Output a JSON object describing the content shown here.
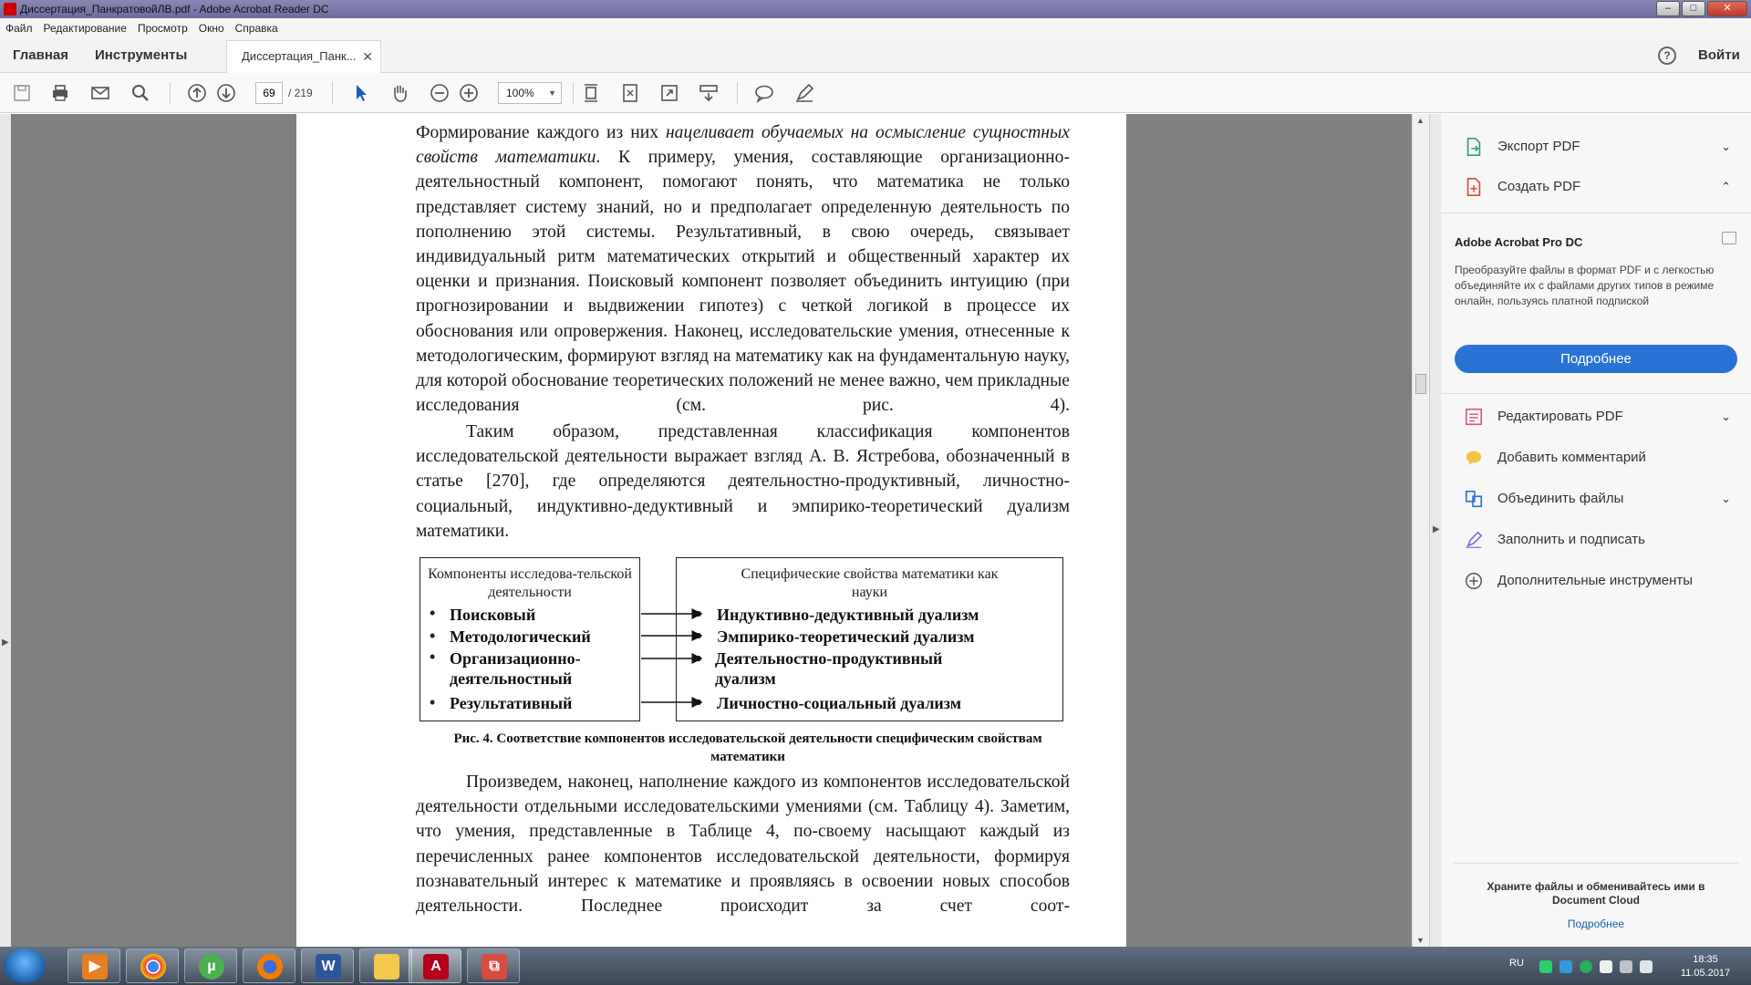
{
  "window": {
    "title": "Диссертация_ПанкратовойЛВ.pdf - Adobe Acrobat Reader DC"
  },
  "menu": [
    "Файл",
    "Редактирование",
    "Просмотр",
    "Окно",
    "Справка"
  ],
  "nav": {
    "home": "Главная",
    "tools": "Инструменты",
    "doc_tab": "Диссертация_Панк...",
    "sign_in": "Войти",
    "help": "?"
  },
  "toolbar": {
    "page_current": "69",
    "page_total": "/ 219",
    "zoom": "100%"
  },
  "document": {
    "para1": "Формирование каждого из них ",
    "para1_it": "нацеливает обучаемых на осмысление сущностных свойств математики",
    "para1_rest": ". К примеру, умения, составляющие организационно-деятельностный компонент, помогают понять, что математика не только представляет систему знаний, но и предполагает определенную деятельность по пополнению этой системы. Результативный, в свою очередь, связывает индивидуальный ритм математических открытий и общественный характер их оценки и признания. Поисковый компонент позволяет объединить интуицию (при прогнозировании и выдвижении гипотез) с четкой логикой в процессе их обоснования или опровержения. Наконец, исследовательские умения, отнесенные к методологическим, формируют взгляд на математику как на фундаментальную науку, для которой обоснование теоретических положений не менее важно, чем прикладные исследования (см. рис. 4).",
    "para2": "Таким образом, представленная классификация компонентов исследовательской деятельности выражает взгляд А. В. Ястребова, обозначенный в статье [270], где определяются деятельностно-продуктивный, личностно-социальный, индуктивно-дедуктивный и эмпирико-теоретический дуализм математики.",
    "para3": "Произведем, наконец, наполнение каждого из компонентов исследовательской деятельности отдельными исследовательскими умениями (см. Таблицу 4). Заметим, что умения, представленные в Таблице 4, по-своему насыщают каждый из перечисленных ранее компонентов исследовательской деятельности, формируя познавательный интерес к математике и проявляясь в освоении новых способов деятельности. Последнее происходит за счет соот-"
  },
  "figure": {
    "left_head": "Компоненты исследова-тельской деятельности",
    "left_items": [
      "Поисковый",
      "Методологический",
      "Организационно-деятельностный",
      "Результативный"
    ],
    "right_head": "Специфические свойства математики как науки",
    "right_items": [
      "Индуктивно-дедуктивный дуализм",
      "Эмпирико-теоретический дуализм",
      "Деятельностно-продуктивный дуализм",
      "Личностно-социальный дуализм"
    ],
    "caption": "Рис. 4. Соответствие компонентов исследовательской деятельности специфическим свойствам математики"
  },
  "right_panel": {
    "export": "Экспорт PDF",
    "create": "Создать PDF",
    "promo_title": "Adobe Acrobat Pro DC",
    "promo_text": "Преобразуйте файлы в формат PDF и с легкостью объединяйте их с файлами других типов в режиме онлайн, пользуясь платной подпиской",
    "promo_button": "Подробнее",
    "edit": "Редактировать PDF",
    "comment": "Добавить комментарий",
    "combine": "Объединить файлы",
    "fill_sign": "Заполнить и подписать",
    "more_tools": "Дополнительные инструменты",
    "cloud_text": "Храните файлы и обменивайтесь ими в Document Cloud",
    "cloud_link": "Подробнее"
  },
  "taskbar": {
    "lang": "RU",
    "time": "18:35",
    "date": "11.05.2017"
  },
  "colors": {
    "accent": "#2a73d5",
    "page_bg": "#808080"
  }
}
